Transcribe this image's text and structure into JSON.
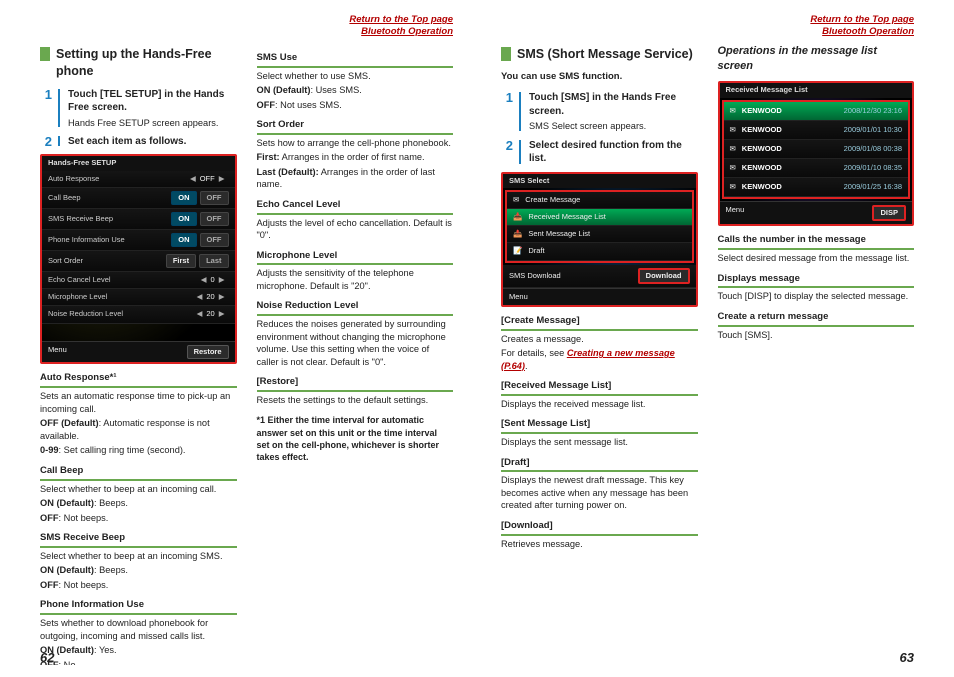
{
  "nav": {
    "return": "Return to the Top page",
    "section": "Bluetooth Operation"
  },
  "pageLeft": "62",
  "pageRight": "63",
  "left": {
    "heading": "Setting up the Hands-Free phone",
    "step1": {
      "text": "Touch [TEL SETUP] in the Hands Free screen.",
      "note": "Hands Free SETUP screen appears."
    },
    "step2": {
      "text": "Set each item as follows."
    },
    "ss": {
      "title": "Hands-Free SETUP",
      "rows": [
        {
          "name": "Auto Response",
          "left": "◀",
          "val": "OFF",
          "right": "▶"
        },
        {
          "name": "Call Beep",
          "on": "ON",
          "off": "OFF"
        },
        {
          "name": "SMS Receive Beep",
          "on": "ON",
          "off": "OFF"
        },
        {
          "name": "Phone Information Use",
          "on": "ON",
          "off": "OFF"
        },
        {
          "name": "Sort Order",
          "first": "First",
          "last": "Last"
        },
        {
          "name": "Echo Cancel Level",
          "left": "◀",
          "val": "0",
          "right": "▶"
        },
        {
          "name": "Microphone Level",
          "left": "◀",
          "val": "20",
          "right": "▶"
        },
        {
          "name": "Noise Reduction Level",
          "left": "◀",
          "val": "20",
          "right": "▶"
        }
      ],
      "menu": "Menu",
      "restore": "Restore"
    },
    "items": [
      {
        "head": "Auto Response*¹",
        "body": "Sets an automatic response time to pick-up an incoming call.",
        "opts": [
          {
            "k": "OFF (Default)",
            "v": ": Automatic response is not available."
          },
          {
            "k": "0-99",
            "v": ": Set calling ring time (second)."
          }
        ]
      },
      {
        "head": "Call Beep",
        "body": "Select whether to beep at an incoming call.",
        "opts": [
          {
            "k": "ON (Default)",
            "v": ": Beeps."
          },
          {
            "k": "OFF",
            "v": ": Not beeps."
          }
        ]
      },
      {
        "head": "SMS Receive Beep",
        "body": "Select whether to beep at an incoming SMS.",
        "opts": [
          {
            "k": "ON (Default)",
            "v": ": Beeps."
          },
          {
            "k": "OFF",
            "v": ": Not beeps."
          }
        ]
      },
      {
        "head": "Phone Information Use",
        "body": "Sets whether to download phonebook for outgoing, incoming and missed calls list.",
        "opts": [
          {
            "k": "ON (Default)",
            "v": ": Yes."
          },
          {
            "k": "OFF",
            "v": ": No."
          }
        ]
      }
    ],
    "col2": [
      {
        "head": "SMS Use",
        "body": "Select whether to use SMS.",
        "opts": [
          {
            "k": "ON (Default)",
            "v": ": Uses SMS."
          },
          {
            "k": "OFF",
            "v": ": Not uses SMS."
          }
        ]
      },
      {
        "head": "Sort Order",
        "body": "Sets how to arrange the cell-phone phonebook.",
        "opts": [
          {
            "k": "First:",
            "v": " Arranges in the order of first name."
          },
          {
            "k": "Last (Default):",
            "v": " Arranges in the order of last name."
          }
        ]
      },
      {
        "head": "Echo Cancel Level",
        "body": "Adjusts the level of echo cancellation. Default is \"0\"."
      },
      {
        "head": "Microphone Level",
        "body": "Adjusts the sensitivity of the telephone microphone. Default is \"20\"."
      },
      {
        "head": "Noise Reduction Level",
        "body": "Reduces the noises generated by surrounding environment without changing the microphone volume. Use this setting when the voice of caller is not clear. Default is \"0\"."
      },
      {
        "head": "[Restore]",
        "body": "Resets the settings to the default settings."
      }
    ],
    "footnote": "Either the time interval for automatic answer set on this unit or the time interval set on the cell-phone, whichever is shorter takes effect."
  },
  "right": {
    "heading": "SMS (Short Message Service)",
    "intro": "You can use SMS function.",
    "step1": {
      "text": "Touch [SMS] in the Hands Free screen.",
      "note": "SMS Select screen appears."
    },
    "step2": {
      "text": "Select desired function from the list."
    },
    "ss": {
      "title": "SMS Select",
      "rows": [
        "Create Message",
        "Received Message List",
        "Sent Message List",
        "Draft"
      ],
      "dlrow": "SMS Download",
      "dlbtn": "Download",
      "menu": "Menu"
    },
    "items": [
      {
        "head": "[Create Message]",
        "body": "Creates a message.",
        "link_pre": "For details, see ",
        "link": "Creating a new message (P.64)",
        "link_post": "."
      },
      {
        "head": "[Received Message List]",
        "body": "Displays the received message list."
      },
      {
        "head": "[Sent Message List]",
        "body": "Displays the sent message list."
      },
      {
        "head": "[Draft]",
        "body": "Displays the newest draft message. This key becomes active when any message has been created after turning power on."
      },
      {
        "head": "[Download]",
        "body": "Retrieves message."
      }
    ],
    "sub": "Operations in the message list screen",
    "ss2": {
      "title": "Received Message List",
      "rows": [
        {
          "name": "KENWOOD",
          "date": "2008/12/30 23:16"
        },
        {
          "name": "KENWOOD",
          "date": "2009/01/01 10:30"
        },
        {
          "name": "KENWOOD",
          "date": "2009/01/08 00:38"
        },
        {
          "name": "KENWOOD",
          "date": "2009/01/10 08:35"
        },
        {
          "name": "KENWOOD",
          "date": "2009/01/25 16:38"
        }
      ],
      "disp": "DISP",
      "menu": "Menu"
    },
    "items2": [
      {
        "head": "Calls the number in the message",
        "body": "Select desired message from the message list."
      },
      {
        "head": "Displays message",
        "body": "Touch [DISP] to display the selected message."
      },
      {
        "head": "Create a return message",
        "body": "Touch [SMS]."
      }
    ]
  }
}
